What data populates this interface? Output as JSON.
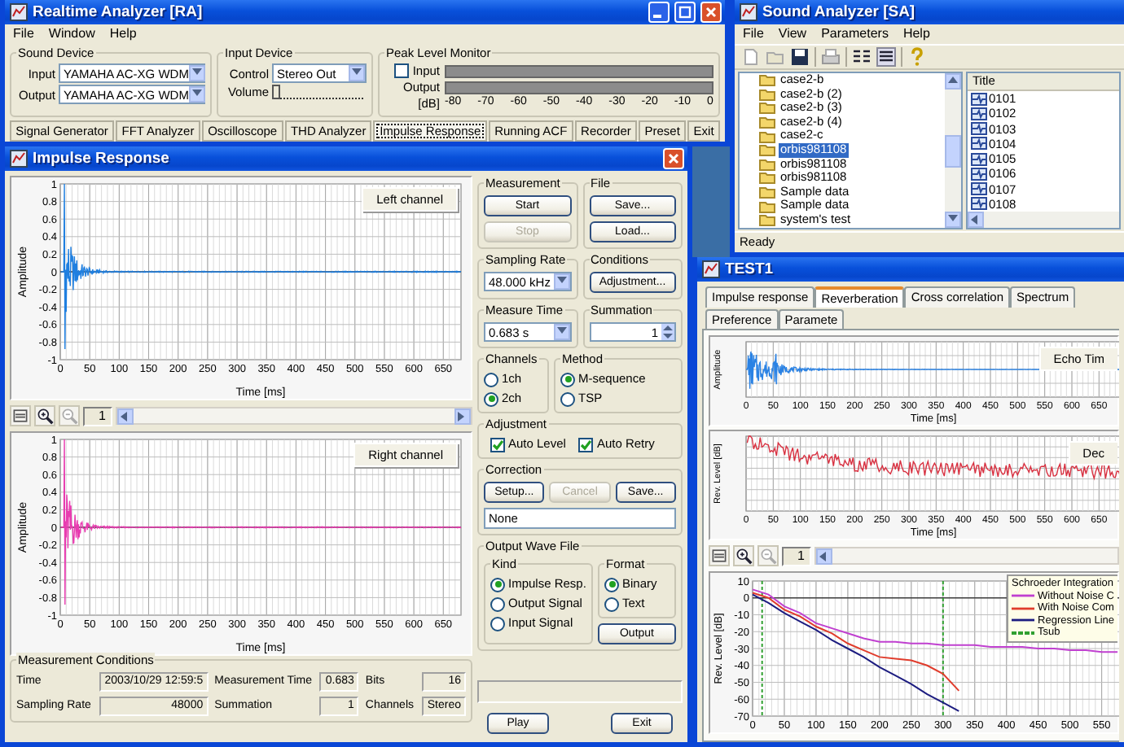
{
  "realtime_analyzer": {
    "title": "Realtime Analyzer [RA]",
    "menu": [
      "File",
      "Window",
      "Help"
    ],
    "sound_device": {
      "label": "Sound Device",
      "fields": [
        {
          "label": "Input",
          "value": "YAMAHA AC-XG WDM"
        },
        {
          "label": "Output",
          "value": "YAMAHA AC-XG WDM"
        }
      ]
    },
    "input_device": {
      "label": "Input Device",
      "control": {
        "label": "Control",
        "value": "Stereo Out"
      },
      "volume": {
        "label": "Volume",
        "level": 0
      }
    },
    "peak_level_monitor": {
      "label": "Peak Level Monitor",
      "input": {
        "label": "Input",
        "checked": false
      },
      "output_label": "Output",
      "unit": "[dB]",
      "scale": [
        "-80",
        "-70",
        "-60",
        "-50",
        "-40",
        "-30",
        "-20",
        "-10",
        "0"
      ]
    },
    "tool_buttons": [
      {
        "label": "Signal Generator",
        "selected": false
      },
      {
        "label": "FFT Analyzer",
        "selected": false
      },
      {
        "label": "Oscilloscope",
        "selected": false
      },
      {
        "label": "THD Analyzer",
        "selected": false
      },
      {
        "label": "Impulse Response",
        "selected": true
      },
      {
        "label": "Running ACF",
        "selected": false
      },
      {
        "label": "Recorder",
        "selected": false
      },
      {
        "label": "Preset",
        "selected": false
      },
      {
        "label": "Exit",
        "selected": false
      }
    ]
  },
  "sound_analyzer": {
    "title": "Sound Analyzer [SA]",
    "menu": [
      "File",
      "View",
      "Parameters",
      "Help"
    ],
    "tree": [
      {
        "label": "case2-b",
        "selected": false
      },
      {
        "label": "case2-b (2)",
        "selected": false
      },
      {
        "label": "case2-b (3)",
        "selected": false
      },
      {
        "label": "case2-b (4)",
        "selected": false
      },
      {
        "label": "case2-c",
        "selected": false
      },
      {
        "label": "orbis981108",
        "selected": true
      },
      {
        "label": "orbis981108",
        "selected": false
      },
      {
        "label": "orbis981108",
        "selected": false
      },
      {
        "label": "Sample data",
        "selected": false
      },
      {
        "label": "Sample data",
        "selected": false
      },
      {
        "label": "system's test",
        "selected": false
      }
    ],
    "list_column": "Title",
    "list": [
      "0101",
      "0102",
      "0103",
      "0104",
      "0105",
      "0106",
      "0107",
      "0108"
    ],
    "status": "Ready"
  },
  "impulse_response": {
    "title": "Impulse Response",
    "charts": [
      {
        "channel": "Left channel",
        "color": "#1f7fe0",
        "ylabel": "Amplitude",
        "xlabel": "Time [ms]",
        "yticks": [
          "1",
          "0.8",
          "0.6",
          "0.4",
          "0.2",
          "0",
          "-0.2",
          "-0.4",
          "-0.6",
          "-0.8",
          "-1"
        ],
        "xticks": [
          "0",
          "50",
          "100",
          "150",
          "200",
          "250",
          "300",
          "350",
          "400",
          "450",
          "500",
          "550",
          "600",
          "650"
        ]
      },
      {
        "channel": "Right channel",
        "color": "#e83cb0",
        "ylabel": "Amplitude",
        "xlabel": "Time [ms]",
        "yticks": [
          "1",
          "0.8",
          "0.6",
          "0.4",
          "0.2",
          "0",
          "-0.2",
          "-0.4",
          "-0.6",
          "-0.8",
          "-1"
        ],
        "xticks": [
          "0",
          "50",
          "100",
          "150",
          "200",
          "250",
          "300",
          "350",
          "400",
          "450",
          "500",
          "550",
          "600",
          "650"
        ]
      }
    ],
    "page": "1",
    "measurement_conditions": {
      "label": "Measurement Conditions",
      "fields": [
        {
          "label": "Time",
          "value": "2003/10/29 12:59:5"
        },
        {
          "label": "Measurement Time",
          "value": "0.683"
        },
        {
          "label": "Bits",
          "value": "16"
        },
        {
          "label": "Sampling Rate",
          "value": "48000"
        },
        {
          "label": "Summation",
          "value": "1"
        },
        {
          "label": "Channels",
          "value": "Stereo"
        }
      ]
    },
    "measurement": {
      "label": "Measurement",
      "buttons": [
        {
          "label": "Start",
          "disabled": false
        },
        {
          "label": "Stop",
          "disabled": true
        }
      ]
    },
    "file": {
      "label": "File",
      "buttons": [
        {
          "label": "Save...",
          "disabled": false
        },
        {
          "label": "Load...",
          "disabled": false
        }
      ]
    },
    "sampling_rate": {
      "label": "Sampling Rate",
      "value": "48.000 kHz"
    },
    "conditions": {
      "label": "Conditions",
      "buttons": [
        {
          "label": "Adjustment...",
          "disabled": false
        }
      ]
    },
    "measure_time": {
      "label": "Measure Time",
      "value": "0.683 s"
    },
    "summation": {
      "label": "Summation",
      "value": "1"
    },
    "channels": {
      "label": "Channels",
      "options": [
        {
          "label": "1ch",
          "selected": false
        },
        {
          "label": "2ch",
          "selected": true
        }
      ]
    },
    "method": {
      "label": "Method",
      "options": [
        {
          "label": "M-sequence",
          "selected": true
        },
        {
          "label": "TSP",
          "selected": false
        }
      ]
    },
    "adjustment": {
      "label": "Adjustment",
      "options": [
        {
          "label": "Auto Level",
          "checked": true
        },
        {
          "label": "Auto Retry",
          "checked": true
        }
      ]
    },
    "correction": {
      "label": "Correction",
      "buttons": [
        {
          "label": "Setup...",
          "disabled": false
        },
        {
          "label": "Cancel",
          "disabled": true
        },
        {
          "label": "Save...",
          "disabled": false
        }
      ],
      "value": "None"
    },
    "output_wave_file": {
      "label": "Output Wave File",
      "kind": {
        "label": "Kind",
        "options": [
          {
            "label": "Impulse Resp.",
            "selected": true
          },
          {
            "label": "Output Signal",
            "selected": false
          },
          {
            "label": "Input Signal",
            "selected": false
          }
        ]
      },
      "format": {
        "label": "Format",
        "options": [
          {
            "label": "Binary",
            "selected": true
          },
          {
            "label": "Text",
            "selected": false
          }
        ]
      },
      "buttons": [
        {
          "label": "Output",
          "disabled": false
        }
      ]
    },
    "bottom_buttons": [
      {
        "label": "Play",
        "disabled": false
      },
      {
        "label": "Exit",
        "disabled": false
      }
    ]
  },
  "test1": {
    "title": "TEST1",
    "tabs": [
      {
        "label": "Impulse response",
        "selected": false
      },
      {
        "label": "Reverberation",
        "selected": true
      },
      {
        "label": "Cross correlation",
        "selected": false
      },
      {
        "label": "Spectrum",
        "selected": false
      },
      {
        "label": "Preference",
        "selected": false
      },
      {
        "label": "Paramete",
        "selected": false
      }
    ],
    "echo_chart": {
      "label": "Echo Tim",
      "ylabel": "Amplitude",
      "xlabel": "Time [ms]",
      "xticks": [
        "0",
        "50",
        "100",
        "150",
        "200",
        "250",
        "300",
        "350",
        "400",
        "450",
        "500",
        "550",
        "600",
        "650"
      ]
    },
    "decay_chart": {
      "label": "Dec",
      "ylabel": "Rev. Level [dB]",
      "xlabel": "Time [ms]",
      "xticks": [
        "0",
        "50",
        "100",
        "150",
        "200",
        "250",
        "300",
        "350",
        "400",
        "450",
        "500",
        "550",
        "600",
        "650"
      ]
    },
    "page": "1",
    "schroeder_chart": {
      "legend_extra_label": "Tsub",
      "chart_data": {
        "type": "line",
        "title": "Schroeder Integration",
        "ylabel": "Rev. Level [dB]",
        "x": [
          0,
          25,
          50,
          75,
          100,
          125,
          150,
          175,
          200,
          225,
          250,
          275,
          300,
          325,
          350,
          375,
          400,
          425,
          450,
          475,
          500,
          525,
          550,
          575
        ],
        "series": [
          {
            "name": "Without Noise C",
            "color": "#c040d0",
            "values": [
              5,
              2,
              -5,
              -9,
              -15,
              -18,
              -21,
              -24,
              -26,
              -26,
              -27,
              -27,
              -28,
              -28,
              -28,
              -29,
              -29,
              -29,
              -30,
              -30,
              -31,
              -31,
              -32,
              -32
            ]
          },
          {
            "name": "With Noise Com",
            "color": "#e03c2c",
            "values": [
              3,
              0,
              -7,
              -11,
              -17,
              -21,
              -27,
              -31,
              -35,
              -36,
              -37,
              -40,
              -45,
              -55,
              null,
              null,
              null,
              null,
              null,
              null,
              null,
              null,
              null,
              null
            ]
          },
          {
            "name": "Regression Line",
            "color": "#1c1c80",
            "values": [
              2,
              -3,
              -9,
              -14,
              -19,
              -25,
              -30,
              -35,
              -41,
              -46,
              -51,
              -57,
              -62,
              -67,
              null,
              null,
              null,
              null,
              null,
              null,
              null,
              null,
              null,
              null
            ]
          }
        ],
        "xlim": [
          0,
          580
        ],
        "ylim": [
          -70,
          10
        ],
        "xticks": [
          0,
          50,
          100,
          150,
          200,
          250,
          300,
          350,
          400,
          450,
          500,
          550
        ],
        "yticks": [
          10,
          0,
          -10,
          -20,
          -30,
          -40,
          -50,
          -60,
          -70
        ],
        "grid": true,
        "legend": "upper right",
        "ref_lines": [
          {
            "axis": "x",
            "value": 15,
            "color": "#30a030"
          },
          {
            "axis": "x",
            "value": 300,
            "color": "#30a030"
          }
        ]
      }
    }
  }
}
